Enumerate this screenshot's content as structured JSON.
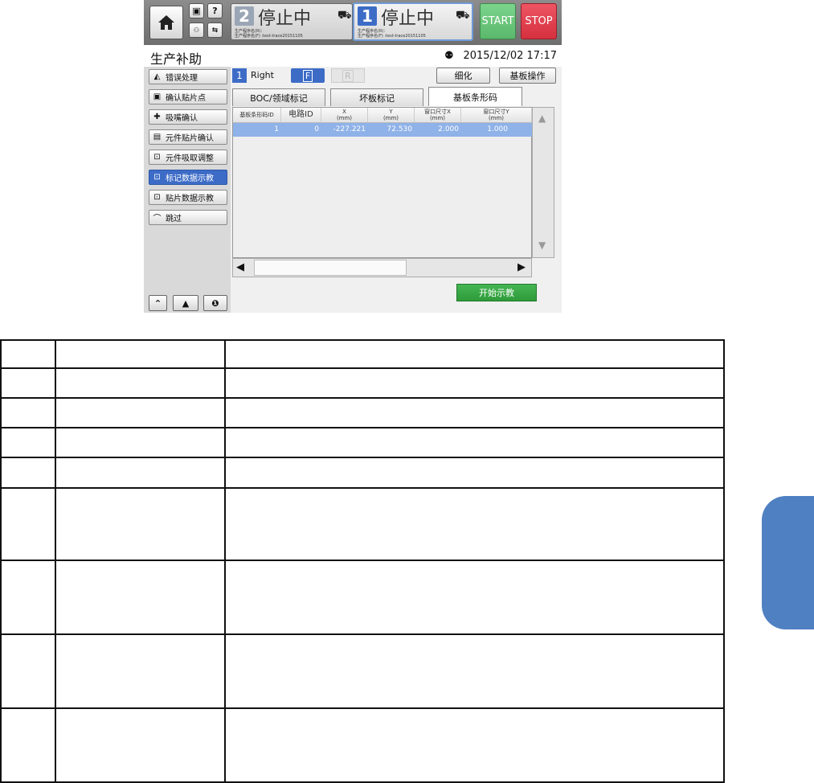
{
  "header": {
    "lanes": [
      {
        "number": "2",
        "status": "停止中",
        "program_rear": "生产程序名(R)：",
        "program_front": "生产程序名(F) :test-trace20151105"
      },
      {
        "number": "1",
        "status": "停止中",
        "program_rear": "生产程序名(R)：",
        "program_front": "生产程序名(F) :test-trace20151105"
      }
    ],
    "start_label": "START",
    "stop_label": "STOP"
  },
  "title_bar": {
    "title": "生产补助",
    "datetime": "2015/12/02 17:17"
  },
  "sidebar": {
    "items": [
      {
        "label": "错误处理",
        "icon": "error-handling-icon",
        "glyph": "◭"
      },
      {
        "label": "确认贴片点",
        "icon": "placement-check-icon",
        "glyph": "▣"
      },
      {
        "label": "吸嘴确认",
        "icon": "nozzle-icon",
        "glyph": "✚"
      },
      {
        "label": "元件贴片确认",
        "icon": "component-mount-icon",
        "glyph": "▤"
      },
      {
        "label": "元件吸取调整",
        "icon": "pickup-adjust-icon",
        "glyph": "⊡"
      },
      {
        "label": "标记数据示教",
        "icon": "mark-teach-icon",
        "glyph": "⊡"
      },
      {
        "label": "贴片数据示教",
        "icon": "placement-teach-icon",
        "glyph": "⊡"
      },
      {
        "label": "跳过",
        "icon": "skip-icon",
        "glyph": "⌒"
      }
    ]
  },
  "controls": {
    "lane_number": "1",
    "lane_label": "Right",
    "front_label": "F",
    "rear_label": "R",
    "detail_button": "细化",
    "board_ops_button": "基板操作"
  },
  "tabs": [
    {
      "label": "BOC/领域标记",
      "active": false
    },
    {
      "label": "坏板标记",
      "active": false
    },
    {
      "label": "基板条形码",
      "active": true
    }
  ],
  "grid": {
    "columns": [
      {
        "name": "基板条形码ID",
        "unit": ""
      },
      {
        "name": "电路ID",
        "unit": ""
      },
      {
        "name": "X",
        "unit": "(mm)"
      },
      {
        "name": "Y",
        "unit": "(mm)"
      },
      {
        "name": "窗口尺寸X",
        "unit": "(mm)"
      },
      {
        "name": "窗口尺寸Y",
        "unit": "(mm)"
      }
    ],
    "rows": [
      [
        "1",
        "0",
        "-227.221",
        "72.530",
        "2.000",
        "1.000"
      ]
    ]
  },
  "teach_button": "开始示教",
  "colors": {
    "accent": "#3d6cc7",
    "start": "#2f9b3a",
    "stop": "#d5303e",
    "selected_row": "#8fb2e8",
    "side_tab": "#4f80c2"
  }
}
